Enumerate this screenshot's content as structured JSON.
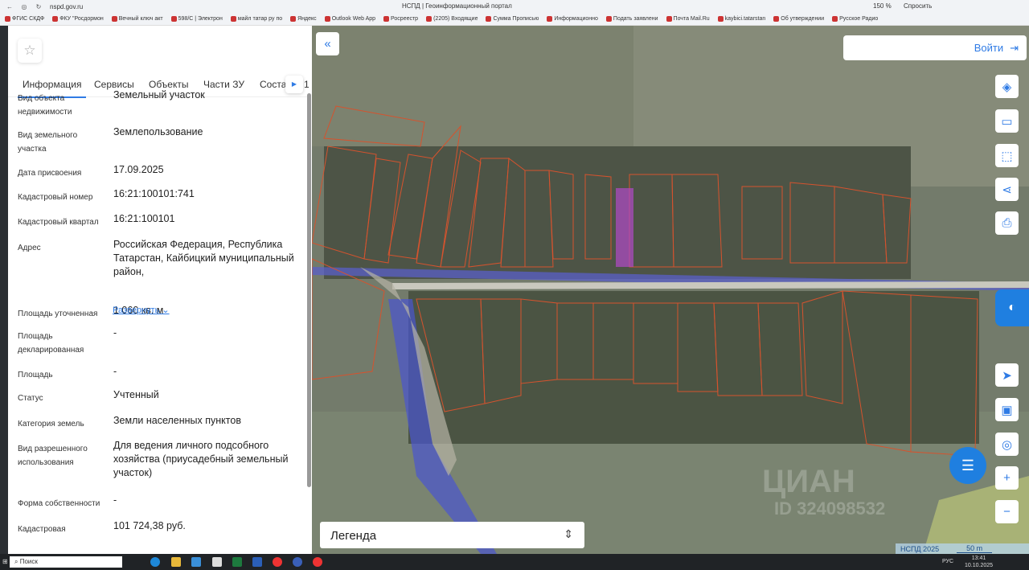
{
  "browser": {
    "url": "nspd.gov.ru",
    "title": "НСПД | Геоинформационный портал",
    "zoom": "150 %",
    "ask": "Спросить"
  },
  "bookmarks": [
    "ФГИС СКДФ",
    "ФКУ \"Росдормон",
    "Вечный ключ акт",
    "598/C | Электрон",
    "майл татар ру по",
    "Яндекс",
    "Outlook Web App",
    "Росреестр",
    "(2205) Входящие",
    "Сумма Прописью",
    "Информационно",
    "Подать заявлени",
    "Почта Mail.Ru",
    "kaybici.tatarstan",
    "Об утверждении",
    "Русское Радио"
  ],
  "tabs": [
    "Информация",
    "Сервисы",
    "Объекты",
    "Части ЗУ",
    "Состав"
  ],
  "tab_extra": "1",
  "fields": [
    {
      "label": "Вид объекта недвижимости",
      "value": "Земельный участок"
    },
    {
      "label": "Вид земельного участка",
      "value": "Землепользование"
    },
    {
      "label": "Дата присвоения",
      "value": "17.09.2025"
    },
    {
      "label": "Кадастровый номер",
      "value": "16:21:100101:741"
    },
    {
      "label": "Кадастровый квартал",
      "value": "16:21:100101"
    },
    {
      "label": "Адрес",
      "value": "Российская Федерация, Республика Татарстан, Кайбицкий муниципальный район,"
    },
    {
      "label": "Площадь уточненная",
      "value": "1 060 кв. м"
    },
    {
      "label": "Площадь декларированная",
      "value": "-"
    },
    {
      "label": "Площадь",
      "value": "-"
    },
    {
      "label": "Статус",
      "value": "Учтенный"
    },
    {
      "label": "Категория земель",
      "value": "Земли населенных пунктов"
    },
    {
      "label": "Вид разрешенного использования",
      "value": "Для ведения личного подсобного хозяйства (приусадебный земельный участок)"
    },
    {
      "label": "Форма собственности",
      "value": "-"
    },
    {
      "label": "Кадастровая",
      "value": "101 724,38 руб."
    }
  ],
  "expand": "Развернуть",
  "map": {
    "login": "Войти",
    "legend": "Легенда",
    "attribution": "НСПД 2025",
    "scale": "50 m",
    "watermark": "ЦИАН",
    "watermark_id": "ID 324098532"
  },
  "taskbar": {
    "search": "Поиск",
    "lang": "РУС",
    "time": "13:41",
    "date": "10.10.2025"
  }
}
